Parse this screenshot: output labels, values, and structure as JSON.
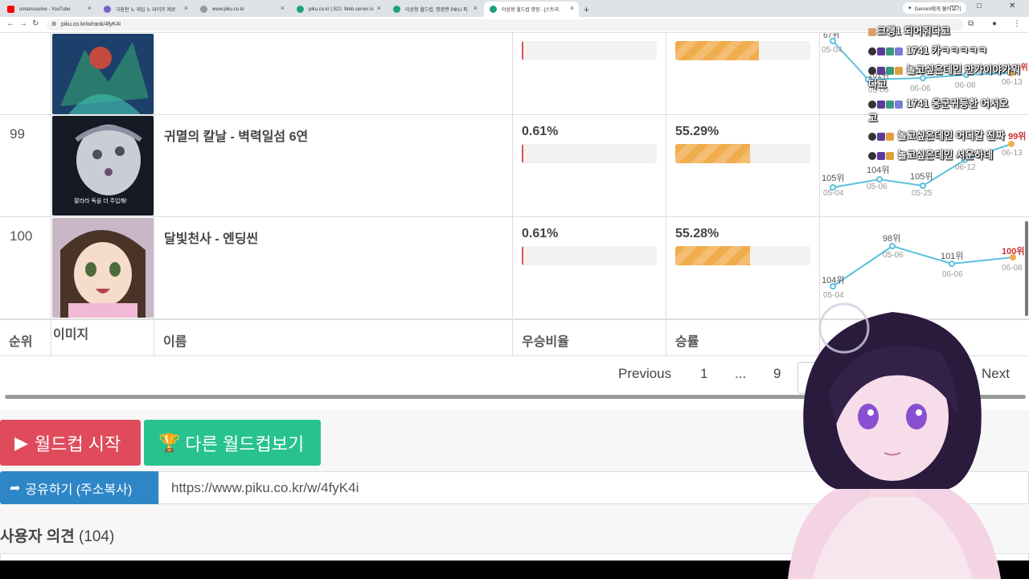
{
  "browser": {
    "tabs": [
      {
        "title": "umamusume - YouTube",
        "color": "#ff0000"
      },
      {
        "title": "극장판 노 게임 노 라이프 제로",
        "color": "#7b61c4"
      },
      {
        "title": "www.piku.co.kr",
        "color": "#999999"
      },
      {
        "title": "piku.co.kr | 521: Web server is",
        "color": "#1aa37a"
      },
      {
        "title": "이상형 월드컵, 명장면 PIKU 피",
        "color": "#1aa37a"
      },
      {
        "title": "이상형 월드컵 명장 - [스트리",
        "color": "#1aa37a",
        "active": true
      }
    ],
    "gemini_button": "Gemini에게 물어보기",
    "url": "piku.co.kr/w/rank/4fyK4i"
  },
  "table": {
    "rows": [
      {
        "rank": "",
        "name": "",
        "win_ratio": "",
        "win_rate": "",
        "win_ratio_value": 0.61,
        "win_rate_value": 61.0
      },
      {
        "rank": "99",
        "name": "귀멸의 칼날 - 벽력일섬 6연",
        "win_ratio": "0.61%",
        "win_rate": "55.29%",
        "win_ratio_value": 0.61,
        "win_rate_value": 55.29,
        "thumb_caption": "팔라라 독을 더 주입해!"
      },
      {
        "rank": "100",
        "name": "달빛천사 - 엔딩씬",
        "win_ratio": "0.61%",
        "win_rate": "55.28%",
        "win_ratio_value": 0.61,
        "win_rate_value": 55.28
      }
    ],
    "headers": {
      "rank": "순위",
      "image": "이미지",
      "name": "이름",
      "win_ratio": "우승비율",
      "win_rate": "승률"
    },
    "row1_chart": {
      "labels": [
        "05-04",
        "05-06",
        "06-06",
        "06-08",
        "06-13"
      ],
      "ranks": [
        "67위",
        "101위",
        "100위",
        "",
        "1위"
      ]
    },
    "row2_chart": {
      "labels": [
        "05-04",
        "05-06",
        "05-25",
        "06-12",
        "06-13"
      ],
      "ranks": [
        "105위",
        "104위",
        "105위",
        "",
        "99위"
      ]
    },
    "row3_chart": {
      "labels": [
        "05-04",
        "05-06",
        "06-06",
        "06-08"
      ],
      "ranks": [
        "104위",
        "98위",
        "101위",
        "100위"
      ]
    }
  },
  "pager": {
    "previous": "Previous",
    "p1": "1",
    "ellipsis": "...",
    "p9": "9",
    "next": "Next"
  },
  "actions": {
    "start": "월드컵 시작",
    "other": "다른 월드컵보기",
    "share": "공유하기 (주소복사)",
    "share_url": "https://www.piku.co.kr/w/4fyK4i"
  },
  "comments": {
    "title": "사용자 의견",
    "count": "(104)"
  },
  "chat": [
    {
      "text": "크랭1 되어줘다고"
    },
    {
      "text": "1741 카ㅋㅋㅋㅋㅋ"
    },
    {
      "text": "놀고싶은데인 만가이야가워"
    },
    {
      "text": "다고"
    },
    {
      "text": "1741 응군귀등한 어서오"
    },
    {
      "text": "고"
    },
    {
      "text": "놀고싶은데인 어디갈 진짜"
    },
    {
      "text": "놀고싶은데인 서운하네"
    }
  ]
}
